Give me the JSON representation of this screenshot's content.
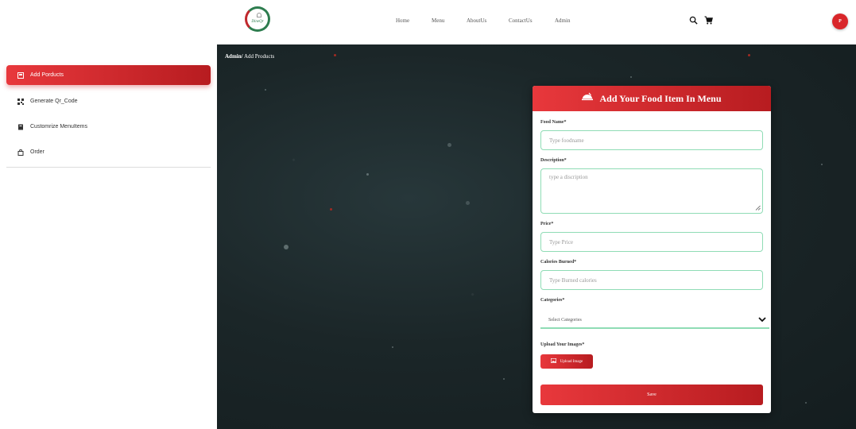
{
  "brand": {
    "logo_text": "DineQr"
  },
  "nav": {
    "links": [
      {
        "label": "Home"
      },
      {
        "label": "Menu"
      },
      {
        "label": "AboutUs"
      },
      {
        "label": "ContactUs"
      },
      {
        "label": "Admin"
      }
    ],
    "search_icon": "search-icon",
    "cart_icon": "cart-icon",
    "avatar_initial": "P"
  },
  "sidebar": {
    "items": [
      {
        "label": "Add Porducts",
        "icon": "add-product-icon",
        "active": true
      },
      {
        "label": "Generate Qr_Code",
        "icon": "qr-code-icon",
        "active": false
      },
      {
        "label": "Customrize MenuItems",
        "icon": "menu-items-icon",
        "active": false
      },
      {
        "label": "Order",
        "icon": "order-icon",
        "active": false
      }
    ]
  },
  "breadcrumb": {
    "root": "Admin/",
    "current": "Add Products"
  },
  "form": {
    "title": "Add Your Food Item In Menu",
    "title_icon": "food-dish-icon",
    "food_name": {
      "label": "Food Name*",
      "placeholder": "Type foodname",
      "value": ""
    },
    "description": {
      "label": "Description*",
      "placeholder": "type a discription",
      "value": ""
    },
    "price": {
      "label": "Price*",
      "placeholder": "Type Price",
      "value": ""
    },
    "calories": {
      "label": "Calories Burned*",
      "placeholder": "Type Burned calories",
      "value": ""
    },
    "categories": {
      "label": "Categories*",
      "selected": "Select Categories"
    },
    "images": {
      "label": "Upload Your Images*",
      "button_label": "Upload Image"
    },
    "save_label": "Save"
  },
  "colors": {
    "accent_red": "#d9262a",
    "input_border_green": "#8fdcb5",
    "background_dark": "#1b2628"
  }
}
